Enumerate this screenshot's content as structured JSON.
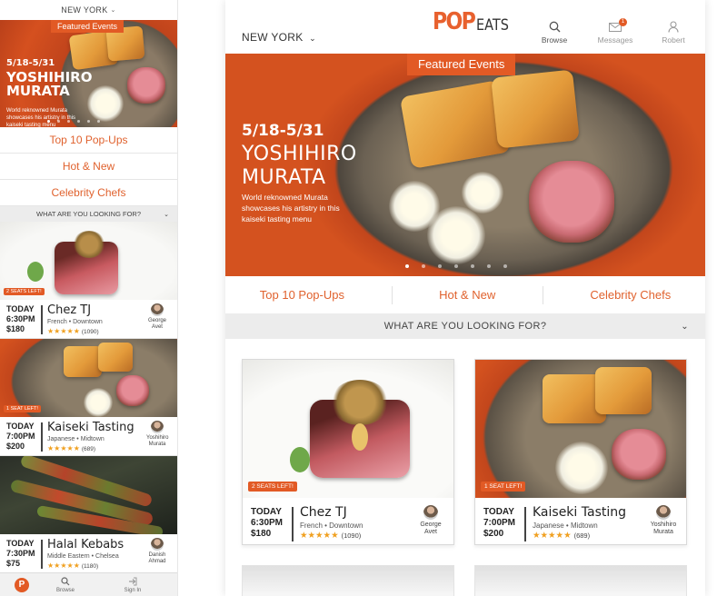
{
  "mobile": {
    "city": "NEW YORK",
    "hero": {
      "badge": "Featured Events",
      "date": "5/18-5/31",
      "name_line1": "YOSHIHIRO",
      "name_line2": "MURATA",
      "desc": "World reknowned Murata showcases his artistry in this kaiseki tasting menu"
    },
    "links": [
      "Top 10 Pop-Ups",
      "Hot & New",
      "Celebrity Chefs"
    ],
    "looking": "WHAT ARE YOU LOOKING FOR?",
    "cards": [
      {
        "seats": "2 SEATS LEFT!",
        "day": "TODAY",
        "time": "6:30PM",
        "price": "$180",
        "title": "Chez TJ",
        "sub": "French • Downtown",
        "stars": "★★★★★",
        "reviews": "(1090)",
        "chef_line1": "George",
        "chef_line2": "Avet"
      },
      {
        "seats": "1 SEAT LEFT!",
        "day": "TODAY",
        "time": "7:00PM",
        "price": "$200",
        "title": "Kaiseki Tasting",
        "sub": "Japanese • Midtown",
        "stars": "★★★★★",
        "reviews": "(689)",
        "chef_line1": "Yoshihiro",
        "chef_line2": "Murata"
      },
      {
        "day": "TODAY",
        "time": "7:30PM",
        "price": "$75",
        "title": "Halal Kebabs",
        "sub": "Middle Eastern • Chelsea",
        "stars": "★★★★★",
        "reviews": "(1180)",
        "chef_line1": "Danish",
        "chef_line2": "Ahmad"
      }
    ],
    "tabbar": {
      "logo": "P",
      "browse": "Browse",
      "signin": "Sign In"
    }
  },
  "tablet": {
    "city": "NEW YORK",
    "logo_pop": "POP",
    "logo_eats": "EATS",
    "nav": {
      "browse": "Browse",
      "messages": "Messages",
      "messages_count": "1",
      "user": "Robert"
    },
    "hero": {
      "badge": "Featured Events",
      "date": "5/18-5/31",
      "name_line1": "YOSHIHIRO",
      "name_line2": "MURATA",
      "desc": "World reknowned Murata showcases his artistry in this kaiseki tasting menu"
    },
    "links": [
      "Top 10 Pop-Ups",
      "Hot & New",
      "Celebrity Chefs"
    ],
    "looking": "WHAT ARE YOU LOOKING FOR?",
    "cards": [
      {
        "seats": "2 SEATS LEFT!",
        "day": "TODAY",
        "time": "6:30PM",
        "price": "$180",
        "title": "Chez TJ",
        "sub": "French • Downtown",
        "stars": "★★★★★",
        "reviews": "(1090)",
        "chef_line1": "George",
        "chef_line2": "Avet"
      },
      {
        "seats": "1 SEAT LEFT!",
        "day": "TODAY",
        "time": "7:00PM",
        "price": "$200",
        "title": "Kaiseki Tasting",
        "sub": "Japanese • Midtown",
        "stars": "★★★★★",
        "reviews": "(689)",
        "chef_line1": "Yoshihiro",
        "chef_line2": "Murata"
      }
    ]
  },
  "colors": {
    "accent": "#e25a25",
    "link": "#e0622e",
    "star": "#f0a020"
  },
  "icons": {
    "chevron": "chevron-down-icon",
    "browse": "search-icon",
    "messages": "envelope-icon",
    "user": "user-icon",
    "signin": "sign-in-icon"
  }
}
